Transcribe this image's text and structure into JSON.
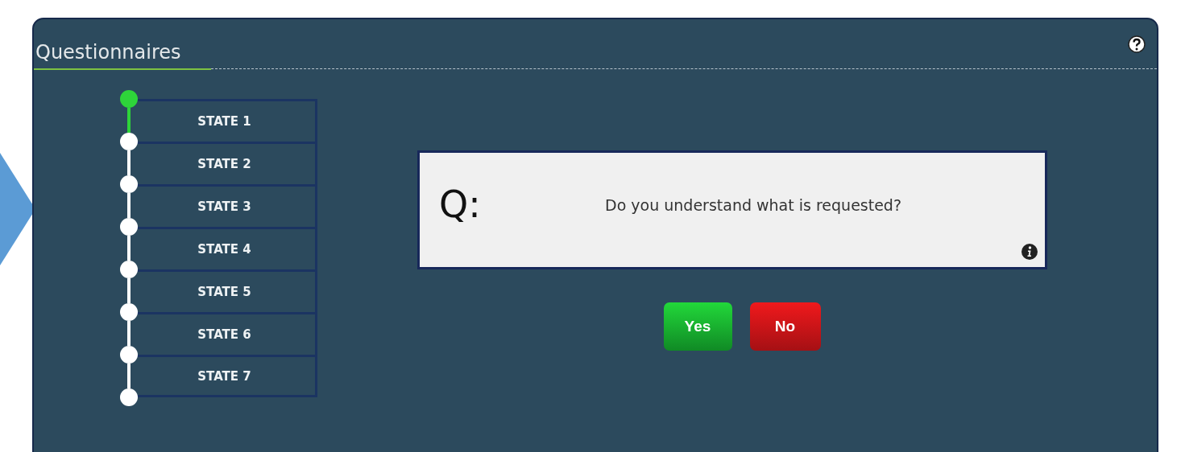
{
  "panel": {
    "title": "Questionnaires"
  },
  "states": [
    {
      "label": "STATE 1",
      "selected": true
    },
    {
      "label": "STATE 2",
      "selected": false
    },
    {
      "label": "STATE 3",
      "selected": false
    },
    {
      "label": "STATE 4",
      "selected": false
    },
    {
      "label": "STATE 5",
      "selected": false
    },
    {
      "label": "STATE 6",
      "selected": false
    },
    {
      "label": "STATE 7",
      "selected": false
    }
  ],
  "question": {
    "prefix": "Q:",
    "text": "Do you understand what is requested?"
  },
  "buttons": [
    {
      "label": "Yes",
      "kind": "yes"
    },
    {
      "label": "No",
      "kind": "no"
    }
  ]
}
